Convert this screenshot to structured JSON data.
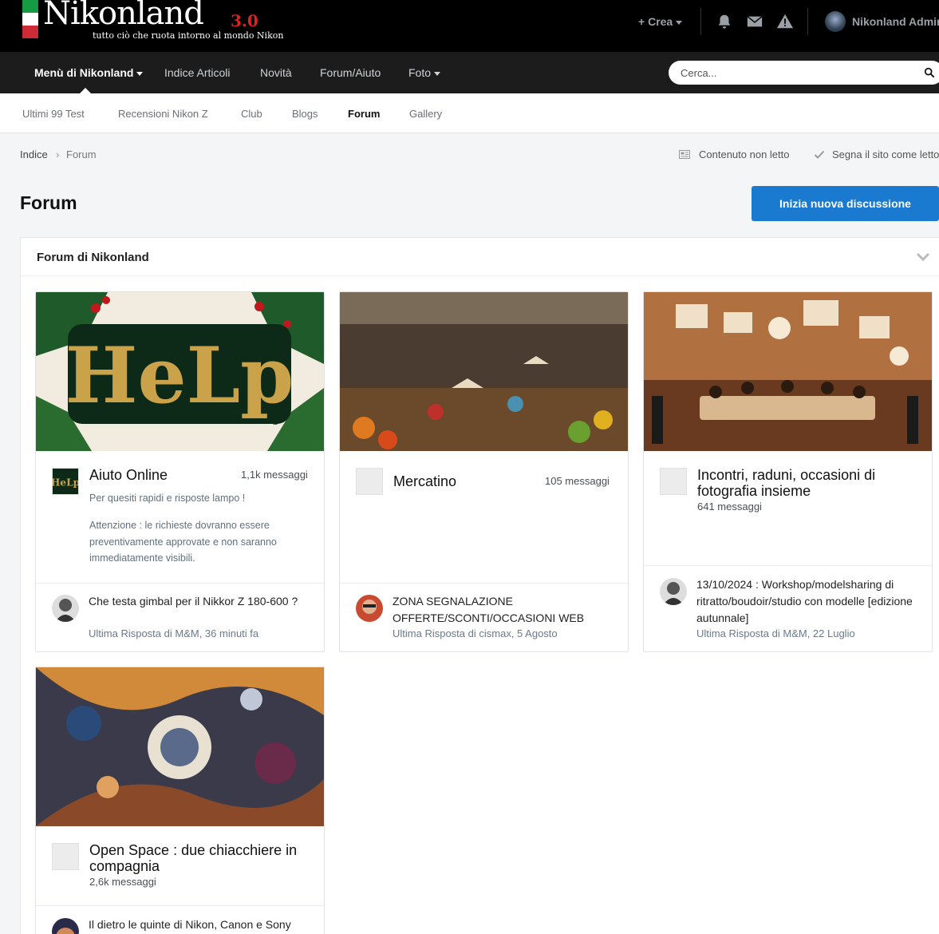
{
  "brand": {
    "name": "Nikonland",
    "version": "3.0",
    "tagline": "tutto ciò che ruota intorno al mondo Nikon"
  },
  "user_bar": {
    "create_label": "Crea",
    "user_name": "Nikonland Admin",
    "icons": [
      "bell-icon",
      "envelope-icon",
      "warning-icon"
    ]
  },
  "main_nav": {
    "items": [
      {
        "label": "Menù di Nikonland",
        "has_caret": true,
        "active": true
      },
      {
        "label": "Indice Articoli"
      },
      {
        "label": "Novità"
      },
      {
        "label": "Forum/Aiuto"
      },
      {
        "label": "Foto",
        "has_caret": true
      }
    ],
    "search_placeholder": "Cerca..."
  },
  "sub_nav": {
    "items": [
      "Ultimi 99 Test",
      "Recensioni Nikon Z",
      "Club",
      "Blogs",
      "Forum",
      "Gallery"
    ],
    "active": "Forum"
  },
  "breadcrumb": {
    "items": [
      "Indice",
      "Forum"
    ],
    "actions": [
      "Contenuto non letto",
      "Segna il sito come letto"
    ]
  },
  "page": {
    "title": "Forum",
    "new_topic_label": "Inizia nuova discussione"
  },
  "section": {
    "title": "Forum di Nikonland",
    "forums": [
      {
        "name": "Aiuto Online",
        "count": "1,1k messaggi",
        "desc1": "Per quesiti rapidi e risposte lampo !",
        "desc2": "Attenzione : le richieste dovranno essere preventivamente approvate e non saranno immediatamente visibili.",
        "last_title": "Che testa gimbal per il Nikkor Z 180-600 ?",
        "last_meta": "Ultima Risposta di M&M, 36 minuti fa"
      },
      {
        "name": "Mercatino",
        "count": "105 messaggi",
        "last_title": "ZONA SEGNALAZIONE OFFERTE/SCONTI/OCCASIONI WEB",
        "last_meta": "Ultima Risposta di cismax, 5 Agosto"
      },
      {
        "name": "Incontri, raduni, occasioni di fotografia insieme",
        "count": "641 messaggi",
        "last_title": "13/10/2024 : Workshop/modelsharing di ritratto/boudoir/studio con modelle [edizione autunnale]",
        "last_meta": "Ultima Risposta di M&M, 22 Luglio"
      },
      {
        "name": "Open Space : due chiacchiere in compagnia",
        "count": "2,6k messaggi",
        "last_title": "Il dietro le quinte di Nikon, Canon e Sony"
      }
    ]
  },
  "colors": {
    "header_bg": "#000000",
    "nav_bg": "#1c1c1c",
    "accent": "#1a7ad0",
    "flag_green": "#169b45",
    "flag_red": "#ce2b37"
  }
}
